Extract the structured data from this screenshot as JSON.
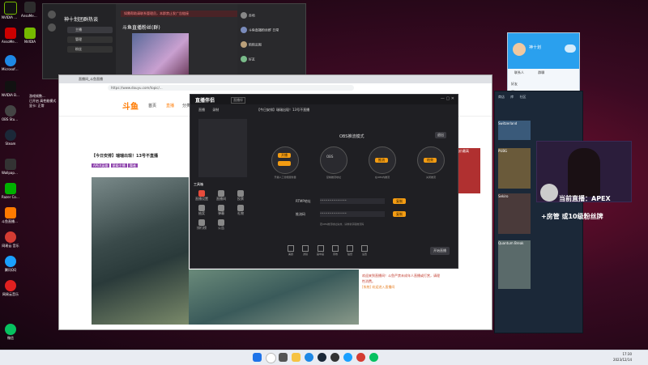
{
  "desktop": {
    "icons": [
      {
        "label": "NVIDIA\nGeForce",
        "color": "#000000"
      },
      {
        "label": "AnsoMedia\nRECentral 4",
        "color": "#2d2d2d"
      },
      {
        "label": "AnsoMedia\nAssist Ce...",
        "color": "#c00"
      },
      {
        "label": "NVIDIA",
        "color": "#76b900"
      },
      {
        "label": "Microsoft\nEdge",
        "color": "#1e88e5"
      },
      {
        "label": "NVIDIA\nBroadcast",
        "color": "#111"
      },
      {
        "label": "OBS Studio",
        "color": "#444"
      },
      {
        "label": "Steam",
        "color": "#1b2838"
      },
      {
        "label": "Wallpaper\nEngine",
        "color": "#333"
      },
      {
        "label": "Razer Cortex",
        "color": "#0c0"
      },
      {
        "label": "斗鱼直播伴侣",
        "color": "#ff7a00"
      },
      {
        "label": "网易云\n音乐",
        "color": "#d43c33"
      },
      {
        "label": "腾讯QQ",
        "color": "#1aa0ff"
      },
      {
        "label": "网易云音乐",
        "color": "#e02020"
      },
      {
        "label": "微信",
        "color": "#07c160"
      }
    ],
    "notice_lines": [
      "游戏帧数...",
      "已开启 高性能模式",
      "显卡: 正常"
    ]
  },
  "chat_window": {
    "group_title": "神十划团群热谈",
    "chat_title": "斗鱼直播粉丝(群)",
    "members": [
      {
        "name": "主播"
      },
      {
        "name": "管理"
      },
      {
        "name": "粉丝"
      }
    ],
    "notice": "如需帮助请联系管理员，本群禁止发广告链接",
    "contacts": [
      {
        "name": "赤哈"
      },
      {
        "name": "斗鱼直播粉丝群 日常"
      },
      {
        "name": "陌陌云图"
      },
      {
        "name": "好友"
      }
    ]
  },
  "browser": {
    "tab_title": "直播间_斗鱼直播",
    "url": "https://www.douyu.com/topic/...",
    "site_name": "斗鱼",
    "nav": [
      "首页",
      "直播",
      "分类",
      "鱼吧"
    ],
    "stream_title": "【今日安排】瑞瑞出现！13号不直播",
    "streamer": "APEX",
    "tags": [
      "APEX英雄",
      "星级主播",
      "舞者"
    ],
    "chat_messages": [
      "欢迎来到直播间！斗鱼严禁未成年人直播或打赏，请理性消费。",
      "[系统] 欢迎进入直播间"
    ],
    "sidebar_promo": "出价最高"
  },
  "obs": {
    "app_title": "直播伴侣",
    "version": "直播伴",
    "stream_title": "【今日安排】瑞瑞出现！13号不直播",
    "tabs": [
      "直播",
      "录制"
    ],
    "mode_label": "OBS推流模式",
    "mode_button": "退出",
    "steps": [
      {
        "pill": "开播",
        "caption": "开播人工智能服务器"
      },
      {
        "pill": "OBS",
        "caption": "复制推流地址"
      },
      {
        "pill": "推流",
        "caption": "在OBS内推流"
      },
      {
        "pill": "结束",
        "caption": "关闭推流"
      }
    ],
    "fields": [
      {
        "label": "RTMP地址",
        "value": "••••••••••••••",
        "button": "复制"
      },
      {
        "label": "推流码",
        "value": "••••••••••••••",
        "button": "复制"
      }
    ],
    "hint": "若OBS推流地址失效，请重新获取推流码",
    "left_tools": [
      "工具箱",
      "直播设置",
      "直播间",
      "投票",
      "抽奖",
      "弹幕",
      "礼物",
      "排行榜",
      "公告"
    ],
    "bottom_tools": [
      "美颜",
      "滤镜",
      "画中画",
      "音效",
      "贴纸",
      "设置"
    ],
    "start_button": "开始直播"
  },
  "qq": {
    "nickname": "神十划",
    "tabs": [
      "联系人",
      "群聊"
    ],
    "items": [
      "好友",
      "iPhone",
      "设备",
      "我的收藏"
    ]
  },
  "steam": {
    "tabs": [
      "商店",
      "库",
      "社区"
    ],
    "games": [
      "Switzerland",
      "PUBG",
      "Sekiro",
      "Quantum Break"
    ]
  },
  "overlay": {
    "now_live": "当前直播：APEX",
    "banner": "+房管   或10级粉丝牌"
  },
  "taskbar": {
    "time": "17:30",
    "date": "2023/12/14"
  },
  "colors": {
    "accent": "#f39c12",
    "douyu_orange": "#ff7a00",
    "obs_bg": "#1f1f23"
  }
}
